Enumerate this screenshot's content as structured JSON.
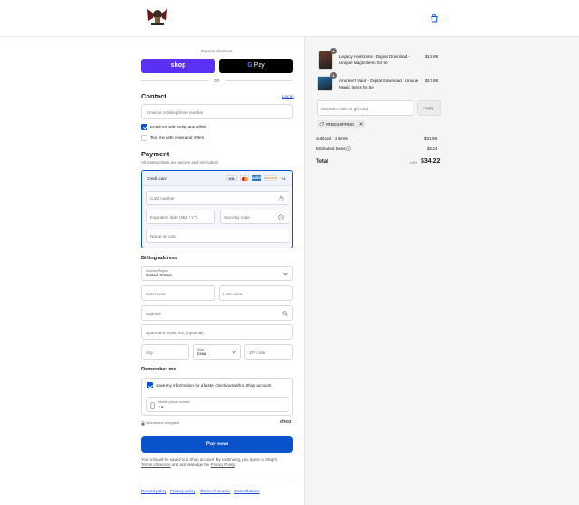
{
  "header": {
    "logo_text": "Pathfinder Vault"
  },
  "express": {
    "title": "Express checkout",
    "shop_label": "shop",
    "gpay_g": "G",
    "gpay_label": "Pay",
    "or_label": "OR"
  },
  "contact": {
    "heading": "Contact",
    "login_label": "Log in",
    "email_placeholder": "Email or mobile phone number",
    "email_news_label": "Email me with news and offers",
    "email_news_checked": true,
    "text_news_label": "Text me with news and offers",
    "text_news_checked": false
  },
  "payment": {
    "heading": "Payment",
    "subtitle": "All transactions are secure and encrypted.",
    "method_label": "Credit card",
    "brands": [
      "VISA",
      "MC",
      "AMEX",
      "DISCOVER"
    ],
    "more_brands": "+4",
    "card_number_placeholder": "Card number",
    "expiry_placeholder": "Expiration date (MM / YY)",
    "cvc_placeholder": "Security code",
    "name_placeholder": "Name on card"
  },
  "billing": {
    "heading": "Billing address",
    "country_label": "Country/Region",
    "country_value": "United States",
    "first_name_placeholder": "First name",
    "last_name_placeholder": "Last name",
    "address_placeholder": "Address",
    "apartment_placeholder": "Apartment, suite, etc. (optional)",
    "city_placeholder": "City",
    "state_label": "State",
    "state_value": "Iowa",
    "zip_placeholder": "ZIP code"
  },
  "remember": {
    "heading": "Remember me",
    "save_label": "Save my information for a faster checkout with a Shop account",
    "save_checked": true,
    "phone_label": "Mobile phone number",
    "phone_value": "+1",
    "secure_label": "Secure and encrypted",
    "shop_brand": "shop"
  },
  "pay_button": "Pay now",
  "legal": {
    "line1": "Your info will be saved to a Shop account. By continuing, you agree to Shop's",
    "terms_link": "Terms of Service",
    "middle": " and acknowledge the ",
    "privacy_link": "Privacy Policy",
    "end": "."
  },
  "footer_links": [
    "Refund policy",
    "Privacy policy",
    "Terms of service",
    "Cancellations"
  ],
  "summary": {
    "items": [
      {
        "title_line1": "Legacy Heirlooms - Digital Download -",
        "title_line2": "Unique Magic Items for 5e",
        "price": "$13.99",
        "qty": "1",
        "thumb_color": "#6b3a2a"
      },
      {
        "title_line1": "Andrew's Vault - Digital Download - Unique",
        "title_line2": "Magic Items for 5e",
        "price": "$17.99",
        "qty": "1",
        "thumb_color": "#1f6fa8"
      }
    ],
    "discount_placeholder": "Discount code or gift card",
    "apply_label": "Apply",
    "code_chip": "FREESHIPPING",
    "subtotal_label": "Subtotal · 2 items",
    "subtotal_value": "$31.98",
    "taxes_label": "Estimated taxes",
    "taxes_value": "$2.24",
    "total_label": "Total",
    "currency": "USD",
    "total_value": "$34.22"
  }
}
